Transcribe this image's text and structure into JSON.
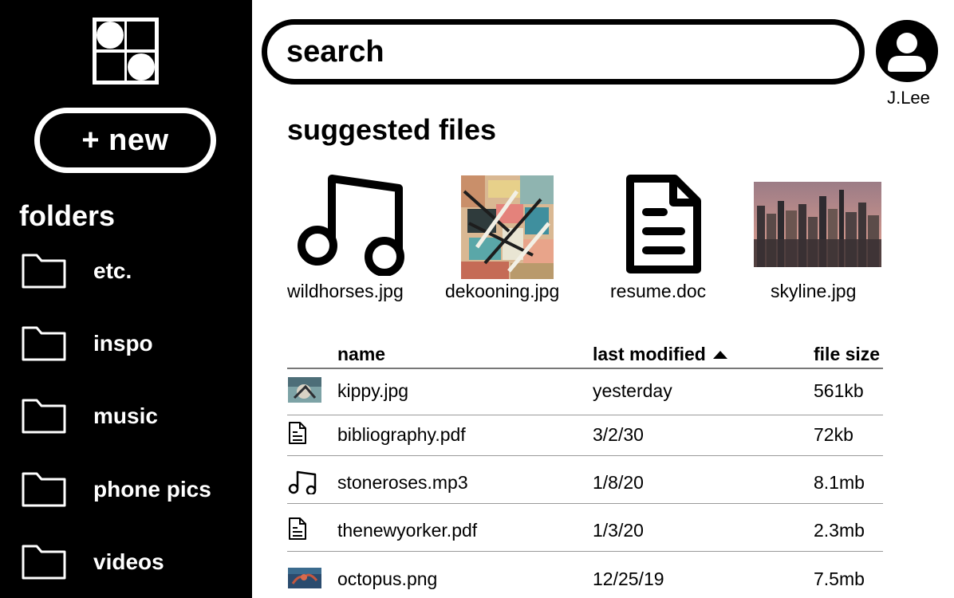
{
  "sidebar": {
    "new_label": "+ new",
    "folders_heading": "folders",
    "folders": [
      {
        "label": "etc.",
        "icon": "folder-icon"
      },
      {
        "label": "inspo",
        "icon": "folder-icon"
      },
      {
        "label": "music",
        "icon": "folder-icon"
      },
      {
        "label": "phone pics",
        "icon": "folder-icon"
      },
      {
        "label": "videos",
        "icon": "folder-icon"
      }
    ]
  },
  "header": {
    "search_placeholder": "search",
    "user_name": "J.Lee"
  },
  "suggested": {
    "heading": "suggested files",
    "files": [
      {
        "name": "wildhorses.jpg",
        "icon": "music-note-icon"
      },
      {
        "name": "dekooning.jpg",
        "icon": "image-thumbnail"
      },
      {
        "name": "resume.doc",
        "icon": "document-icon"
      },
      {
        "name": "skyline.jpg",
        "icon": "image-thumbnail"
      }
    ]
  },
  "table": {
    "columns": {
      "name": "name",
      "modified": "last modified",
      "size": "file size"
    },
    "sort_indicator": "ascending",
    "rows": [
      {
        "name": "kippy.jpg",
        "modified": "yesterday",
        "size": "561kb",
        "icon": "image-thumbnail"
      },
      {
        "name": "bibliography.pdf",
        "modified": "3/2/30",
        "size": "72kb",
        "icon": "document-icon"
      },
      {
        "name": "stoneroses.mp3",
        "modified": "1/8/20",
        "size": "8.1mb",
        "icon": "music-note-icon"
      },
      {
        "name": "thenewyorker.pdf",
        "modified": "1/3/20",
        "size": "2.3mb",
        "icon": "document-icon"
      },
      {
        "name": "octopus.png",
        "modified": "12/25/19",
        "size": "7.5mb",
        "icon": "image-thumbnail"
      }
    ]
  },
  "colors": {
    "sidebar_bg": "#000000",
    "main_bg": "#ffffff",
    "text": "#000000"
  }
}
